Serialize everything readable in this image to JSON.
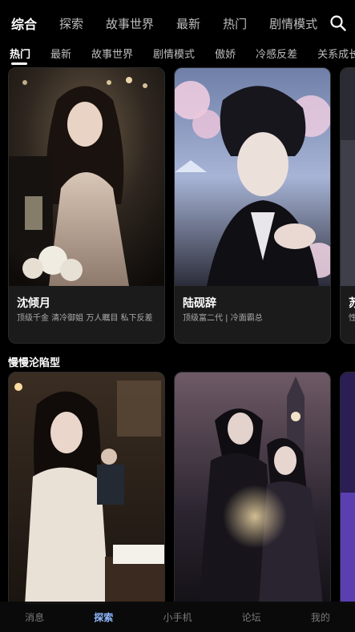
{
  "top_tabs": [
    "综合",
    "探索",
    "故事世界",
    "最新",
    "热门",
    "剧情模式"
  ],
  "sub_tabs": [
    "热门",
    "最新",
    "故事世界",
    "剧情模式",
    "傲娇",
    "冷感反差",
    "关系成长"
  ],
  "row1_cards": [
    {
      "name": "沈倾月",
      "tags": "顶级千金  清冷御姐  万人瞩目  私下反差"
    },
    {
      "name": "陆砚辞",
      "tags": "顶级富二代 | 冷面霸总"
    },
    {
      "name": "苏",
      "tags": "性\n性"
    }
  ],
  "section_title": "慢慢沦陷型",
  "bottom_nav": [
    "消息",
    "探索",
    "小手机",
    "论坛",
    "我的"
  ],
  "colors": {
    "background": "#000000",
    "active_nav": "#8fb8ff",
    "card_bg": "#1b1b1b"
  },
  "icons": {
    "search": "search-icon"
  }
}
